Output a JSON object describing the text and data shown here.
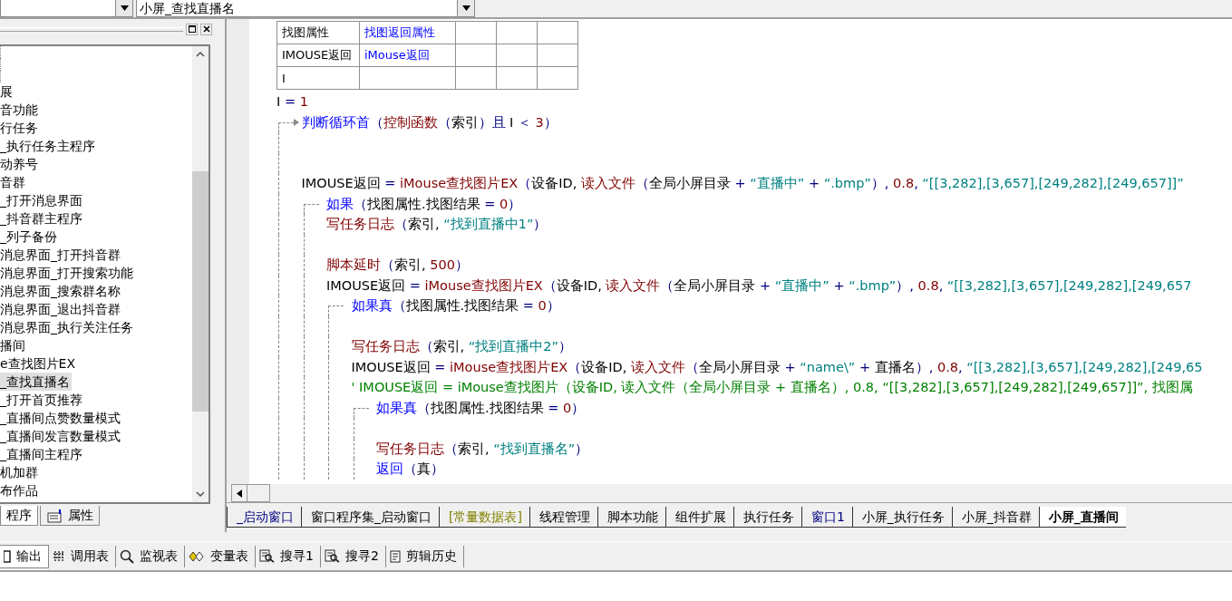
{
  "top_bar": {
    "method_combo": {
      "value": "小屏_查找直播名"
    }
  },
  "left_panel": {
    "items": [
      {
        "label": "展",
        "selected": false
      },
      {
        "label": "音功能",
        "selected": false
      },
      {
        "label": "行任务",
        "selected": false
      },
      {
        "label": "_执行任务主程序",
        "selected": false
      },
      {
        "label": "动养号",
        "selected": false
      },
      {
        "label": "音群",
        "selected": false
      },
      {
        "label": "_打开消息界面",
        "selected": false
      },
      {
        "label": "_抖音群主程序",
        "selected": false
      },
      {
        "label": "_列子备份",
        "selected": false
      },
      {
        "label": "消息界面_打开抖音群",
        "selected": false
      },
      {
        "label": "消息界面_打开搜索功能",
        "selected": false
      },
      {
        "label": "消息界面_搜索群名称",
        "selected": false
      },
      {
        "label": "消息界面_退出抖音群",
        "selected": false
      },
      {
        "label": "消息界面_执行关注任务",
        "selected": false
      },
      {
        "label": "播间",
        "selected": false
      },
      {
        "label": "e查找图片EX",
        "selected": false
      },
      {
        "label": "_查找直播名",
        "selected": true
      },
      {
        "label": "_打开首页推荐",
        "selected": false
      },
      {
        "label": "_直播间点赞数量模式",
        "selected": false
      },
      {
        "label": "_直播间发言数量模式",
        "selected": false
      },
      {
        "label": "_直播间主程序",
        "selected": false
      },
      {
        "label": "机加群",
        "selected": false
      },
      {
        "label": "布作品",
        "selected": false
      }
    ],
    "tabs": [
      {
        "label": "程序",
        "selected": true
      },
      {
        "label": "属性",
        "selected": false
      }
    ]
  },
  "variables_table": {
    "rows": [
      [
        "找图属性",
        "找图返回属性"
      ],
      [
        "IMOUSE返回",
        "iMouse返回"
      ],
      [
        "I"
      ]
    ]
  },
  "code": [
    {
      "tokens": [
        {
          "text": "I",
          "kind": "p"
        },
        {
          "text": " = ",
          "kind": "op"
        },
        {
          "text": "1",
          "kind": "num"
        }
      ]
    },
    {
      "kind": "loop",
      "tokens": [
        {
          "text": "判断循环首",
          "kind": "kw"
        },
        {
          "text": "（",
          "kind": "op"
        },
        {
          "text": "控制函数",
          "kind": "fn"
        },
        {
          "text": "（",
          "kind": "op"
        },
        {
          "text": "索引",
          "kind": "p"
        },
        {
          "text": "）",
          "kind": "op"
        },
        {
          "text": "且",
          "kind": "op"
        },
        {
          "text": " I ",
          "kind": "p"
        },
        {
          "text": "＜ ",
          "kind": "op"
        },
        {
          "text": "3",
          "kind": "num"
        },
        {
          "text": "）",
          "kind": "op"
        }
      ],
      "children": [
        {
          "kind": "blank"
        },
        {
          "kind": "blank"
        },
        {
          "tokens": [
            {
              "text": "IMOUSE返回",
              "kind": "p"
            },
            {
              "text": " = ",
              "kind": "op"
            },
            {
              "text": "iMouse查找图片EX",
              "kind": "fn"
            },
            {
              "text": "（",
              "kind": "op"
            },
            {
              "text": "设备ID, ",
              "kind": "p"
            },
            {
              "text": "读入文件",
              "kind": "fn"
            },
            {
              "text": "（",
              "kind": "op"
            },
            {
              "text": "全局小屏目录",
              "kind": "p"
            },
            {
              "text": " + ",
              "kind": "op"
            },
            {
              "text": "“直播中”",
              "kind": "str"
            },
            {
              "text": " + ",
              "kind": "op"
            },
            {
              "text": "“.bmp”",
              "kind": "str"
            },
            {
              "text": "）, ",
              "kind": "op"
            },
            {
              "text": "0.8",
              "kind": "num"
            },
            {
              "text": ", ",
              "kind": "op"
            },
            {
              "text": "“[[3,282],[3,657],[249,282],[249,657]]”",
              "kind": "str"
            }
          ]
        },
        {
          "kind": "if",
          "tokens": [
            {
              "text": "如果",
              "kind": "kw"
            },
            {
              "text": "（",
              "kind": "op"
            },
            {
              "text": "找图属性.找图结果",
              "kind": "p"
            },
            {
              "text": " = ",
              "kind": "op"
            },
            {
              "text": "0",
              "kind": "num"
            },
            {
              "text": "）",
              "kind": "op"
            }
          ],
          "children": [
            {
              "tokens": [
                {
                  "text": "写任务日志",
                  "kind": "fn"
                },
                {
                  "text": "（",
                  "kind": "op"
                },
                {
                  "text": "索引, ",
                  "kind": "p"
                },
                {
                  "text": "“找到直播中1”",
                  "kind": "str"
                },
                {
                  "text": "）",
                  "kind": "op"
                }
              ]
            },
            {
              "kind": "blank"
            },
            {
              "tokens": [
                {
                  "text": "脚本延时",
                  "kind": "fn"
                },
                {
                  "text": "（",
                  "kind": "op"
                },
                {
                  "text": "索引, ",
                  "kind": "p"
                },
                {
                  "text": "500",
                  "kind": "num"
                },
                {
                  "text": "）",
                  "kind": "op"
                }
              ]
            },
            {
              "tokens": [
                {
                  "text": "IMOUSE返回",
                  "kind": "p"
                },
                {
                  "text": " = ",
                  "kind": "op"
                },
                {
                  "text": "iMouse查找图片EX",
                  "kind": "fn"
                },
                {
                  "text": "（",
                  "kind": "op"
                },
                {
                  "text": "设备ID, ",
                  "kind": "p"
                },
                {
                  "text": "读入文件",
                  "kind": "fn"
                },
                {
                  "text": "（",
                  "kind": "op"
                },
                {
                  "text": "全局小屏目录",
                  "kind": "p"
                },
                {
                  "text": " + ",
                  "kind": "op"
                },
                {
                  "text": "“直播中”",
                  "kind": "str"
                },
                {
                  "text": " + ",
                  "kind": "op"
                },
                {
                  "text": "“.bmp”",
                  "kind": "str"
                },
                {
                  "text": "）, ",
                  "kind": "op"
                },
                {
                  "text": "0.8",
                  "kind": "num"
                },
                {
                  "text": ", ",
                  "kind": "op"
                },
                {
                  "text": "“[[3,282],[3,657],[249,282],[249,657",
                  "kind": "str"
                }
              ]
            },
            {
              "kind": "if",
              "tokens": [
                {
                  "text": "如果真",
                  "kind": "kw"
                },
                {
                  "text": "（",
                  "kind": "op"
                },
                {
                  "text": "找图属性.找图结果",
                  "kind": "p"
                },
                {
                  "text": " = ",
                  "kind": "op"
                },
                {
                  "text": "0",
                  "kind": "num"
                },
                {
                  "text": "）",
                  "kind": "op"
                }
              ],
              "children": [
                {
                  "kind": "blank"
                },
                {
                  "tokens": [
                    {
                      "text": "写任务日志",
                      "kind": "fn"
                    },
                    {
                      "text": "（",
                      "kind": "op"
                    },
                    {
                      "text": "索引, ",
                      "kind": "p"
                    },
                    {
                      "text": "“找到直播中2”",
                      "kind": "str"
                    },
                    {
                      "text": "）",
                      "kind": "op"
                    }
                  ]
                },
                {
                  "tokens": [
                    {
                      "text": "IMOUSE返回",
                      "kind": "p"
                    },
                    {
                      "text": " = ",
                      "kind": "op"
                    },
                    {
                      "text": "iMouse查找图片EX",
                      "kind": "fn"
                    },
                    {
                      "text": "（",
                      "kind": "op"
                    },
                    {
                      "text": "设备ID, ",
                      "kind": "p"
                    },
                    {
                      "text": "读入文件",
                      "kind": "fn"
                    },
                    {
                      "text": "（",
                      "kind": "op"
                    },
                    {
                      "text": "全局小屏目录",
                      "kind": "p"
                    },
                    {
                      "text": " + ",
                      "kind": "op"
                    },
                    {
                      "text": "“name\\”",
                      "kind": "str"
                    },
                    {
                      "text": " + ",
                      "kind": "op"
                    },
                    {
                      "text": "直播名",
                      "kind": "p"
                    },
                    {
                      "text": "）, ",
                      "kind": "op"
                    },
                    {
                      "text": "0.8",
                      "kind": "num"
                    },
                    {
                      "text": ", ",
                      "kind": "op"
                    },
                    {
                      "text": "“[[3,282],[3,657],[249,282],[249,65",
                      "kind": "str"
                    }
                  ]
                },
                {
                  "tokens": [
                    {
                      "text": "' IMOUSE返回 = iMouse查找图片（设备ID, 读入文件（全局小屏目录 + 直播名）, 0.8, “[[3,282],[3,657],[249,282],[249,657]]”, 找图属",
                      "kind": "cm"
                    }
                  ]
                },
                {
                  "kind": "if",
                  "tokens": [
                    {
                      "text": "如果真",
                      "kind": "kw"
                    },
                    {
                      "text": "（",
                      "kind": "op"
                    },
                    {
                      "text": "找图属性.找图结果",
                      "kind": "p"
                    },
                    {
                      "text": " = ",
                      "kind": "op"
                    },
                    {
                      "text": "0",
                      "kind": "num"
                    },
                    {
                      "text": "）",
                      "kind": "op"
                    }
                  ],
                  "children": [
                    {
                      "kind": "blank"
                    },
                    {
                      "tokens": [
                        {
                          "text": "写任务日志",
                          "kind": "fn"
                        },
                        {
                          "text": "（",
                          "kind": "op"
                        },
                        {
                          "text": "索引, ",
                          "kind": "p"
                        },
                        {
                          "text": "“找到直播名”",
                          "kind": "str"
                        },
                        {
                          "text": "）",
                          "kind": "op"
                        }
                      ]
                    },
                    {
                      "tokens": [
                        {
                          "text": "返回",
                          "kind": "kw"
                        },
                        {
                          "text": "（",
                          "kind": "op"
                        },
                        {
                          "text": "真",
                          "kind": "p"
                        },
                        {
                          "text": "）",
                          "kind": "op"
                        }
                      ]
                    }
                  ]
                }
              ]
            }
          ]
        }
      ]
    }
  ],
  "editor_tabs": [
    {
      "label": "_启动窗口",
      "color": "#000080",
      "selected": false
    },
    {
      "label": "窗口程序集_启动窗口",
      "selected": false
    },
    {
      "label": "[常量数据表]",
      "color": "#808000",
      "selected": false
    },
    {
      "label": "线程管理",
      "selected": false
    },
    {
      "label": "脚本功能",
      "selected": false
    },
    {
      "label": "组件扩展",
      "selected": false
    },
    {
      "label": "执行任务",
      "selected": false
    },
    {
      "label": "窗口1",
      "color": "#000080",
      "selected": false
    },
    {
      "label": "小屏_执行任务",
      "selected": false
    },
    {
      "label": "小屏_抖音群",
      "selected": false
    },
    {
      "label": "小屏_直播间",
      "selected": true
    }
  ],
  "bottom_tabs": [
    {
      "label": "输出",
      "kind": "output",
      "selected": true
    },
    {
      "label": "调用表",
      "kind": "calls",
      "selected": false
    },
    {
      "label": "监视表",
      "kind": "watch",
      "selected": false
    },
    {
      "label": "变量表",
      "kind": "vars",
      "selected": false
    },
    {
      "label": "搜寻1",
      "kind": "search",
      "selected": false
    },
    {
      "label": "搜寻2",
      "kind": "search",
      "selected": false
    },
    {
      "label": "剪辑历史",
      "kind": "clip",
      "selected": false
    }
  ]
}
